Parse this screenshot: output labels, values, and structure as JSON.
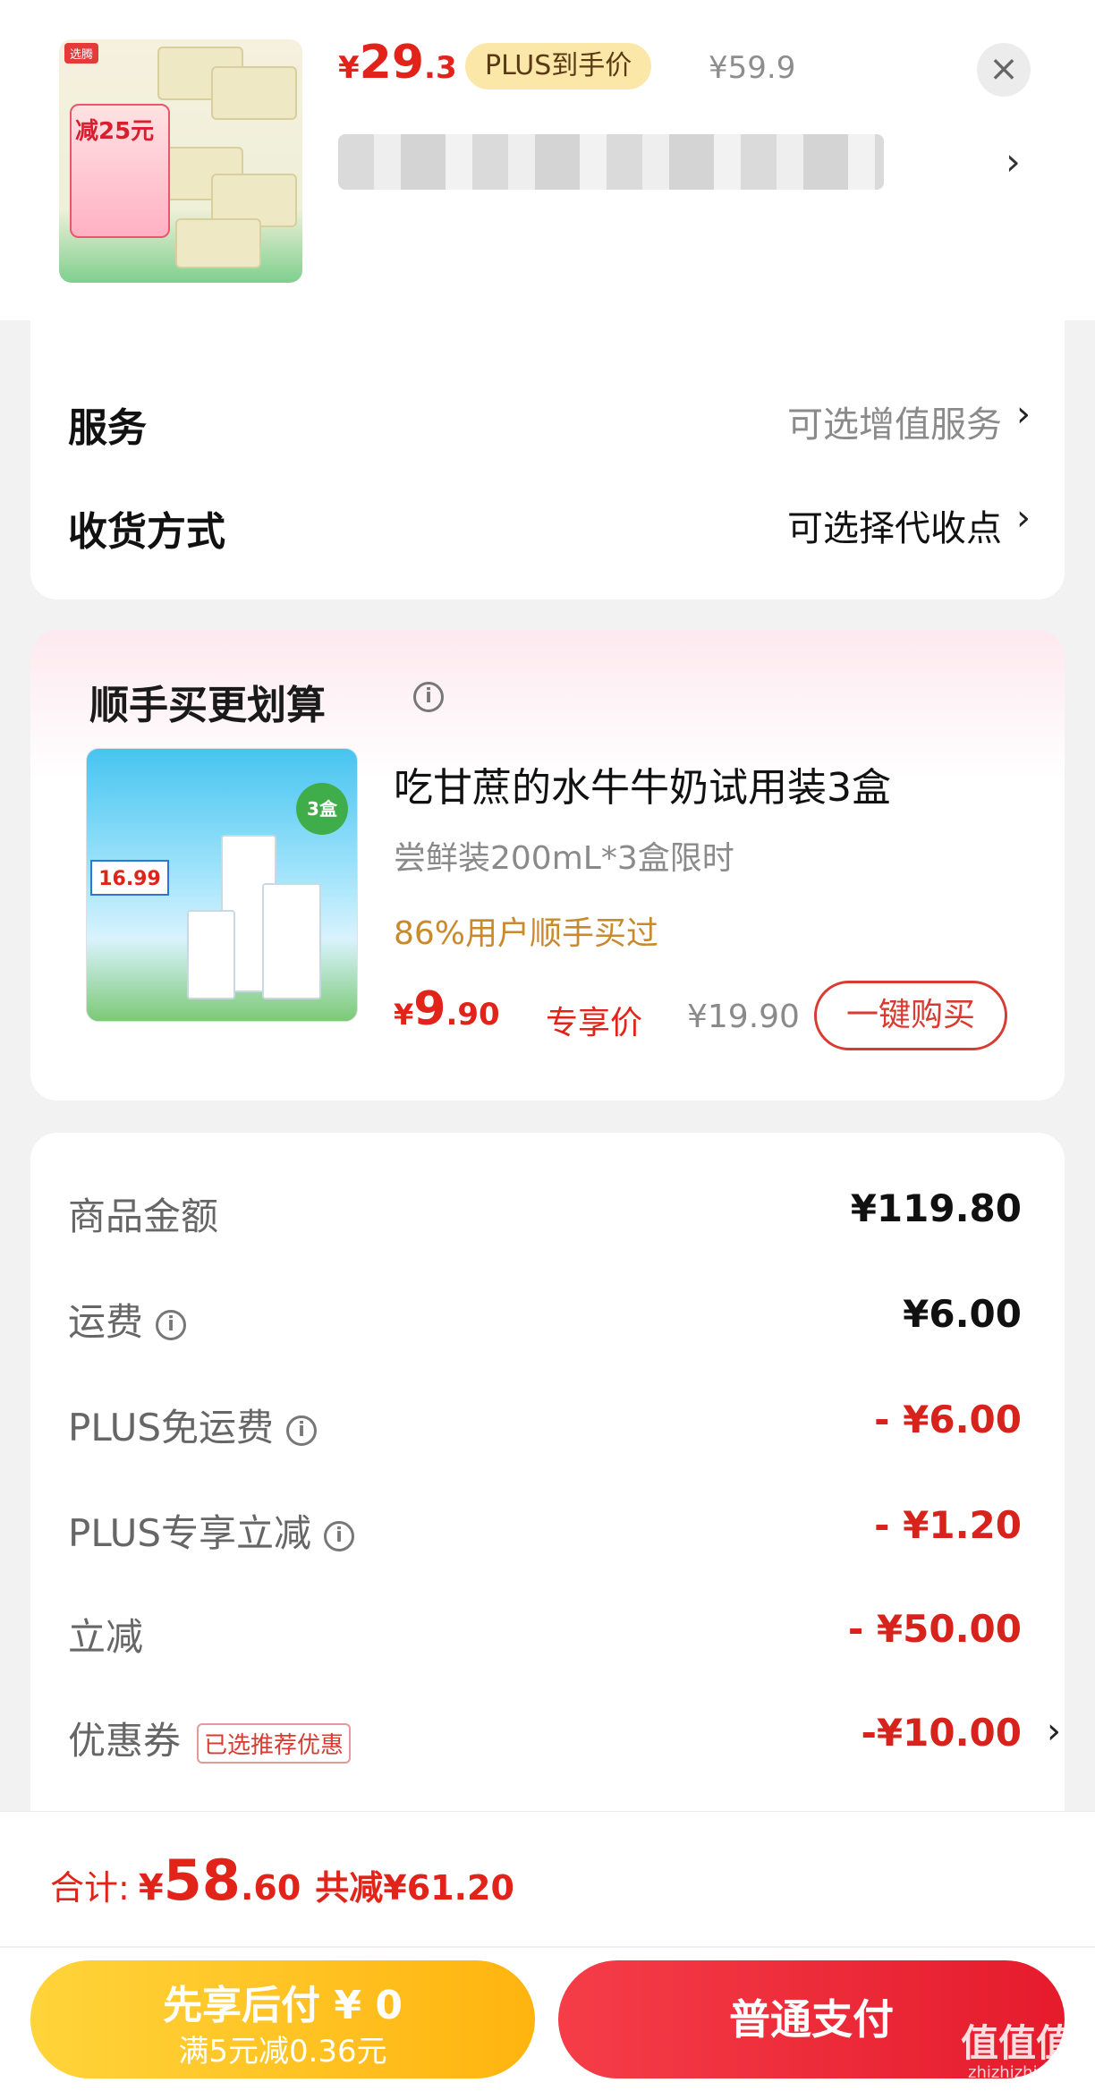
{
  "product": {
    "price_yen": "¥",
    "price_int": "29",
    "price_dec": ".3",
    "plus_label": "PLUS到手价",
    "original_price": "¥59.9",
    "thumb_tag": "选腾",
    "thumb_promo": "减25元"
  },
  "options": [
    {
      "label": "服务",
      "value": "可选增值服务",
      "value_color": "#8a8a8a"
    },
    {
      "label": "收货方式",
      "value": "可选择代收点",
      "value_color": "#111111"
    }
  ],
  "addon": {
    "section_title": "顺手买更划算",
    "name": "吃甘蔗的水牛牛奶试用装3盒",
    "subtitle": "尝鲜装200mL*3盒限时",
    "stat": "86%用户顺手买过",
    "price_yen": "¥",
    "price_int": "9",
    "price_dec": ".90",
    "price_label": "专享价",
    "original_price": "¥19.90",
    "buy_label": "一键购买",
    "img_badge": "3盒",
    "img_price": "16.99"
  },
  "summary": {
    "rows": [
      {
        "label": "商品金额",
        "value": "¥119.80",
        "red": false,
        "info": false
      },
      {
        "label": "运费",
        "value": "¥6.00",
        "red": false,
        "info": true
      },
      {
        "label": "PLUS免运费",
        "value": "- ¥6.00",
        "red": true,
        "info": true
      },
      {
        "label": "PLUS专享立减",
        "value": "- ¥1.20",
        "red": true,
        "info": true
      },
      {
        "label": "立减",
        "value": "- ¥50.00",
        "red": true,
        "info": false
      }
    ],
    "coupon": {
      "label": "优惠券",
      "tag": "已选推荐优惠",
      "value": "-¥10.00"
    }
  },
  "total": {
    "label": "合计:",
    "yen": "¥",
    "int": "58",
    "dec": ".60",
    "saved": "共减¥61.20"
  },
  "actions": {
    "pay_later_title": "先享后付 ¥ 0",
    "pay_later_sub": "满5元减0.36元",
    "pay_normal": "普通支付"
  },
  "watermark": {
    "text": "值值值",
    "sub": "zhizhizhi.com"
  },
  "colors": {
    "accent_red": "#e2231a",
    "plus_gold": "#fbe7a8",
    "pay_yellow": "#ffc21f"
  }
}
